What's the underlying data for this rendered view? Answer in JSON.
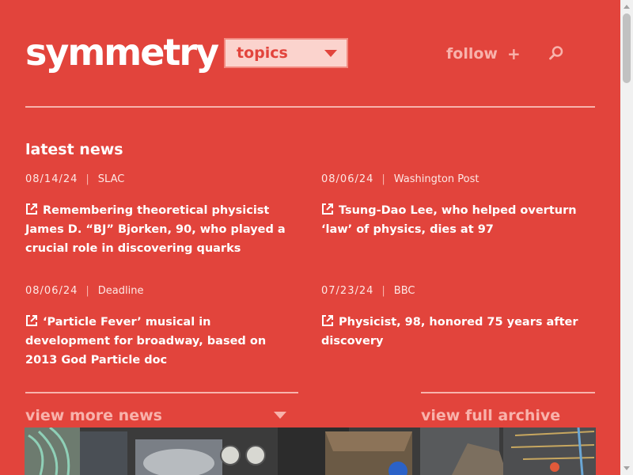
{
  "header": {
    "logo": "symmetry",
    "topics_label": "topics",
    "follow_label": "follow",
    "follow_plus": "+"
  },
  "latest": {
    "title": "latest news",
    "items": [
      {
        "date": "08/14/24",
        "source": "SLAC",
        "headline": "Remembering theoretical physicist James D. “BJ” Bjorken, 90, who played a crucial role in discovering quarks"
      },
      {
        "date": "08/06/24",
        "source": "Washington Post",
        "headline": "Tsung-Dao Lee, who helped overturn ‘law’ of physics, dies at 97"
      },
      {
        "date": "08/06/24",
        "source": "Deadline",
        "headline": "‘Particle Fever’ musical in development for broadway, based on 2013 God Particle doc"
      },
      {
        "date": "07/23/24",
        "source": "BBC",
        "headline": "Physicist, 98, honored 75 years after discovery"
      }
    ],
    "separator": "|",
    "view_more": "view more news",
    "view_archive": "view full archive"
  },
  "colors": {
    "background": "#e2443c",
    "accent_light": "#f8b2ab",
    "topics_bg": "#fbd3cd"
  },
  "icons": {
    "search": "search-icon",
    "external": "external-link-icon",
    "dropdown": "chevron-down-icon"
  }
}
